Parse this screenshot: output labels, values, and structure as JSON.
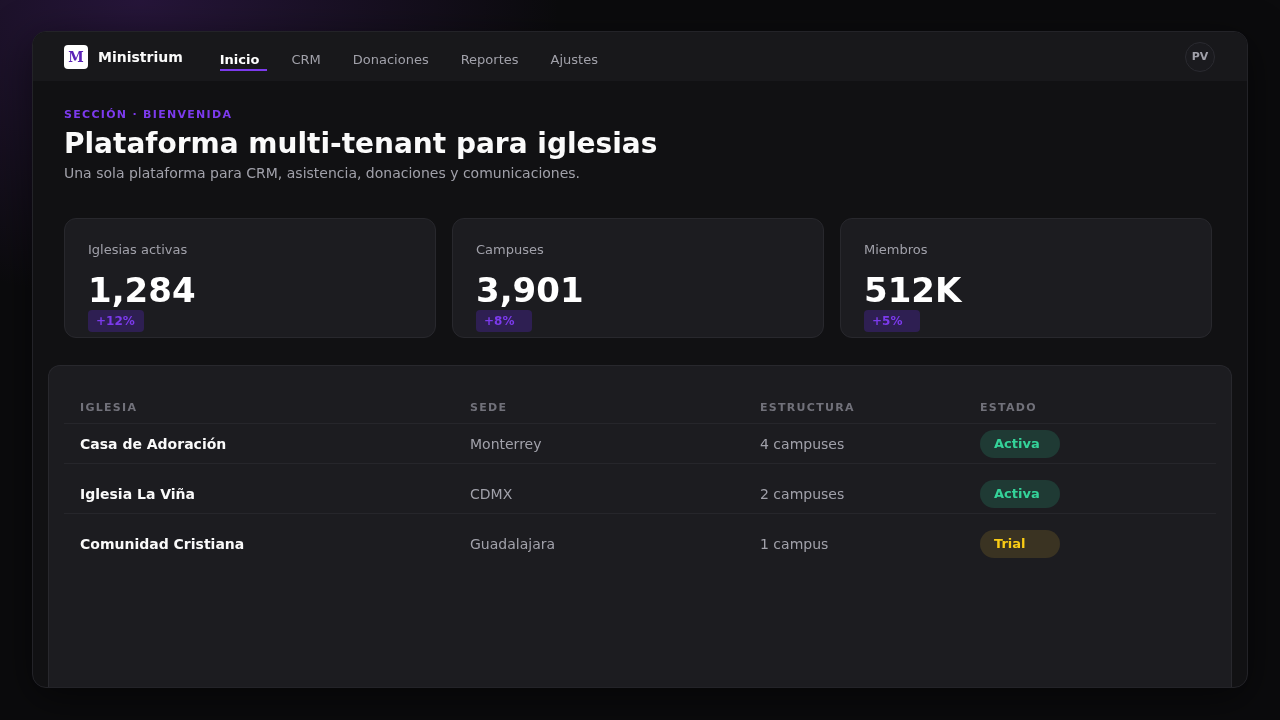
{
  "app": {
    "logo_letter": "M",
    "name": "Ministrium"
  },
  "nav": [
    {
      "label": "Inicio",
      "selected": true
    },
    {
      "label": "CRM",
      "selected": false
    },
    {
      "label": "Donaciones",
      "selected": false
    },
    {
      "label": "Reportes",
      "selected": false
    },
    {
      "label": "Ajustes",
      "selected": false
    }
  ],
  "user": {
    "initials": "PV"
  },
  "hero": {
    "eyebrow": "SECCIÓN · BIENVENIDA",
    "title": "Plataforma multi-tenant para iglesias",
    "subtitle": "Una sola plataforma para CRM, asistencia, donaciones y comunicaciones."
  },
  "stats": [
    {
      "label": "Iglesias activas",
      "value": "1,284",
      "delta": "+12%"
    },
    {
      "label": "Campuses",
      "value": "3,901",
      "delta": "+8%"
    },
    {
      "label": "Miembros",
      "value": "512K",
      "delta": "+5%"
    }
  ],
  "table": {
    "columns": [
      "IGLESIA",
      "SEDE",
      "ESTRUCTURA",
      "ESTADO"
    ],
    "rows": [
      {
        "name": "Casa de Adoración",
        "location": "Monterrey",
        "structure": "4 campuses",
        "status": {
          "label": "Activa",
          "kind": "active"
        }
      },
      {
        "name": "Iglesia La Viña",
        "location": "CDMX",
        "structure": "2 campuses",
        "status": {
          "label": "Activa",
          "kind": "active"
        }
      },
      {
        "name": "Comunidad Cristiana",
        "location": "Guadalajara",
        "structure": "1 campus",
        "status": {
          "label": "Trial",
          "kind": "trial"
        }
      }
    ]
  }
}
